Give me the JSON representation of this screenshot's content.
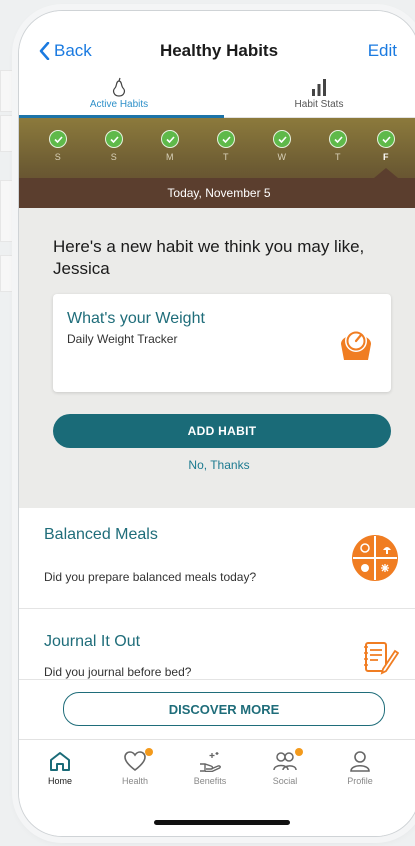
{
  "nav": {
    "back_label": "Back",
    "title": "Healthy Habits",
    "edit_label": "Edit"
  },
  "tabs": [
    {
      "label": "Active Habits",
      "active": true,
      "icon": "pear-icon"
    },
    {
      "label": "Habit Stats",
      "active": false,
      "icon": "bar-chart-icon"
    }
  ],
  "week": {
    "days": [
      {
        "letter": "S",
        "done": true
      },
      {
        "letter": "S",
        "done": true
      },
      {
        "letter": "M",
        "done": true
      },
      {
        "letter": "T",
        "done": true
      },
      {
        "letter": "W",
        "done": true
      },
      {
        "letter": "T",
        "done": true
      },
      {
        "letter": "F",
        "done": true
      }
    ],
    "today_label": "Today, November 5"
  },
  "suggestion": {
    "heading": "Here's a new habit we think you may like, Jessica",
    "card_title": "What's your Weight",
    "card_subtitle": "Daily Weight Tracker",
    "card_icon": "scale-icon",
    "add_label": "ADD HABIT",
    "decline_label": "No, Thanks"
  },
  "habits": [
    {
      "title": "Balanced Meals",
      "question": "Did you prepare balanced meals today?",
      "icon": "balanced-plate-icon"
    },
    {
      "title": "Journal It Out",
      "question": "Did you journal before bed?",
      "icon": "journal-icon"
    }
  ],
  "discover_label": "DISCOVER MORE",
  "tabbar": [
    {
      "label": "Home",
      "icon": "home-icon",
      "active": true,
      "badge": false
    },
    {
      "label": "Health",
      "icon": "heart-icon",
      "active": false,
      "badge": true
    },
    {
      "label": "Benefits",
      "icon": "benefits-hand-icon",
      "active": false,
      "badge": false
    },
    {
      "label": "Social",
      "icon": "people-icon",
      "active": false,
      "badge": true
    },
    {
      "label": "Profile",
      "icon": "person-icon",
      "active": false,
      "badge": false
    }
  ],
  "colors": {
    "accent": "#1a6b78",
    "link": "#1a7ae0",
    "badge": "#f39a1c",
    "icon_orange": "#f07d22"
  }
}
